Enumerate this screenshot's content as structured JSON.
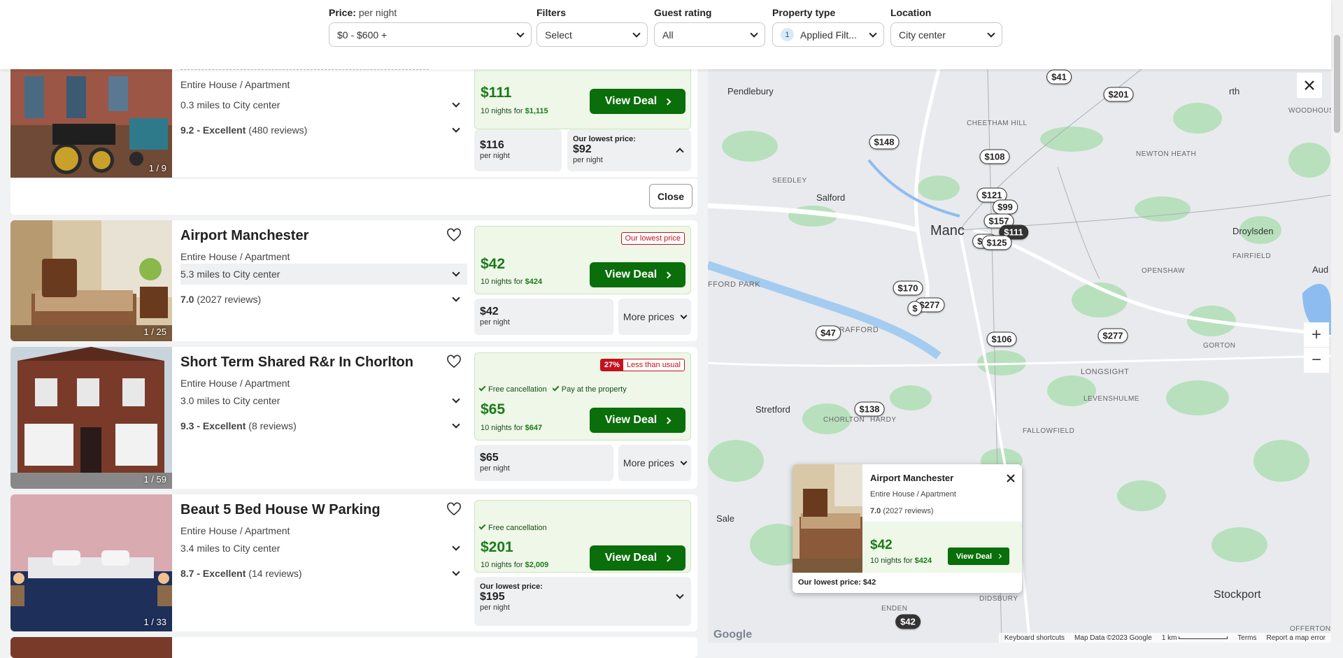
{
  "filters": {
    "price": {
      "label": "Price:",
      "sublabel": "per night",
      "value": "$0 - $600 +"
    },
    "filters": {
      "label": "Filters",
      "value": "Select"
    },
    "guest_rating": {
      "label": "Guest rating",
      "value": "All"
    },
    "property_type": {
      "label": "Property type",
      "count": "1",
      "value": "Applied Filt..."
    },
    "location": {
      "label": "Location",
      "value": "City center"
    }
  },
  "listings": [
    {
      "type": "Entire House / Apartment",
      "distance": "0.3 miles to City center",
      "rating_score": "9.2 - Excellent",
      "rating_reviews": "(480 reviews)",
      "photo_count": "1 / 9",
      "price": "$111",
      "nights_text": "10 nights for",
      "nights_total": "$1,115",
      "view_deal": "View Deal",
      "alt_price": "$116",
      "per_night": "per night",
      "lowest_label": "Our lowest price:",
      "lowest_price": "$92",
      "close_label": "Close"
    },
    {
      "name": "Airport Manchester",
      "type": "Entire House / Apartment",
      "distance": "5.3 miles to City center",
      "rating_score": "7.0",
      "rating_reviews": "(2027 reviews)",
      "photo_count": "1 / 25",
      "badge": "Our lowest price",
      "price": "$42",
      "nights_text": "10 nights for",
      "nights_total": "$424",
      "view_deal": "View Deal",
      "alt_price": "$42",
      "per_night": "per night",
      "more_prices": "More prices"
    },
    {
      "name": "Short Term Shared R&r In Chorlton",
      "type": "Entire House / Apartment",
      "distance": "3.0 miles to City center",
      "rating_score": "9.3 - Excellent",
      "rating_reviews": "(8 reviews)",
      "photo_count": "1 / 59",
      "badge_pct": "27%",
      "badge_text": "Less than usual",
      "perk1": "Free cancellation",
      "perk2": "Pay at the property",
      "price": "$65",
      "nights_text": "10 nights for",
      "nights_total": "$647",
      "view_deal": "View Deal",
      "alt_price": "$65",
      "per_night": "per night",
      "more_prices": "More prices"
    },
    {
      "name": "Beaut 5 Bed House W Parking",
      "type": "Entire House / Apartment",
      "distance": "3.4 miles to City center",
      "rating_score": "8.7 - Excellent",
      "rating_reviews": "(14 reviews)",
      "photo_count": "1 / 33",
      "perk1": "Free cancellation",
      "price": "$201",
      "nights_text": "10 nights for",
      "nights_total": "$2,009",
      "view_deal": "View Deal",
      "lowest_label": "Our lowest price:",
      "lowest_price": "$195",
      "per_night": "per night"
    }
  ],
  "map": {
    "labels": {
      "pendlebury": "Pendlebury",
      "salford": "Salford",
      "manchester": "Manc",
      "droylsden": "Droylsden",
      "openshaw": "OPENSHAW",
      "fairfield": "FAIRFIELD",
      "newton_heath": "NEWTON HEATH",
      "cheetham_hill": "CHEETHAM HILL",
      "seedley": "SEEDLEY",
      "old_trafford": "LD TRAFFORD",
      "salford_park": "FFORD PARK",
      "longsight": "LONGSIGHT",
      "levenshulme": "LEVENSHULME",
      "gorton": "GORTON",
      "fallowfield": "FALLOWFIELD",
      "stretford": "Stretford",
      "chorlton": "CHORLTON",
      "chorlton2": "HARDY",
      "sale": "Sale",
      "stockport": "Stockport",
      "didsbury": "DIDSBURY",
      "woodhouses": "WOODHOUSE",
      "north": "rth",
      "aud": "Aud",
      "offerton": "OFFERTON",
      "enden": "ENDEN"
    },
    "pins": [
      {
        "label": "$41"
      },
      {
        "label": "$201"
      },
      {
        "label": "$148"
      },
      {
        "label": "$108"
      },
      {
        "label": "$121"
      },
      {
        "label": "$99"
      },
      {
        "label": "$157"
      },
      {
        "label": "$111",
        "dark": true
      },
      {
        "label": "$10"
      },
      {
        "label": "$125"
      },
      {
        "label": "$170"
      },
      {
        "label": "$277"
      },
      {
        "label": "$"
      },
      {
        "label": "$106"
      },
      {
        "label": "$47"
      },
      {
        "label": "$277"
      },
      {
        "label": "$138"
      },
      {
        "label": "$42",
        "dark": true
      }
    ],
    "popup": {
      "name": "Airport Manchester",
      "type": "Entire House / Apartment",
      "rating_score": "7.0",
      "rating_reviews": "(2027 reviews)",
      "price": "$42",
      "nights_text": "10 nights for",
      "nights_total": "$424",
      "view_deal": "View Deal",
      "lowest": "Our lowest price: $42"
    },
    "attribution": {
      "google": "Google",
      "shortcuts": "Keyboard shortcuts",
      "mapdata": "Map Data ©2023 Google",
      "scale": "1 km",
      "terms": "Terms",
      "report": "Report a map error"
    }
  }
}
